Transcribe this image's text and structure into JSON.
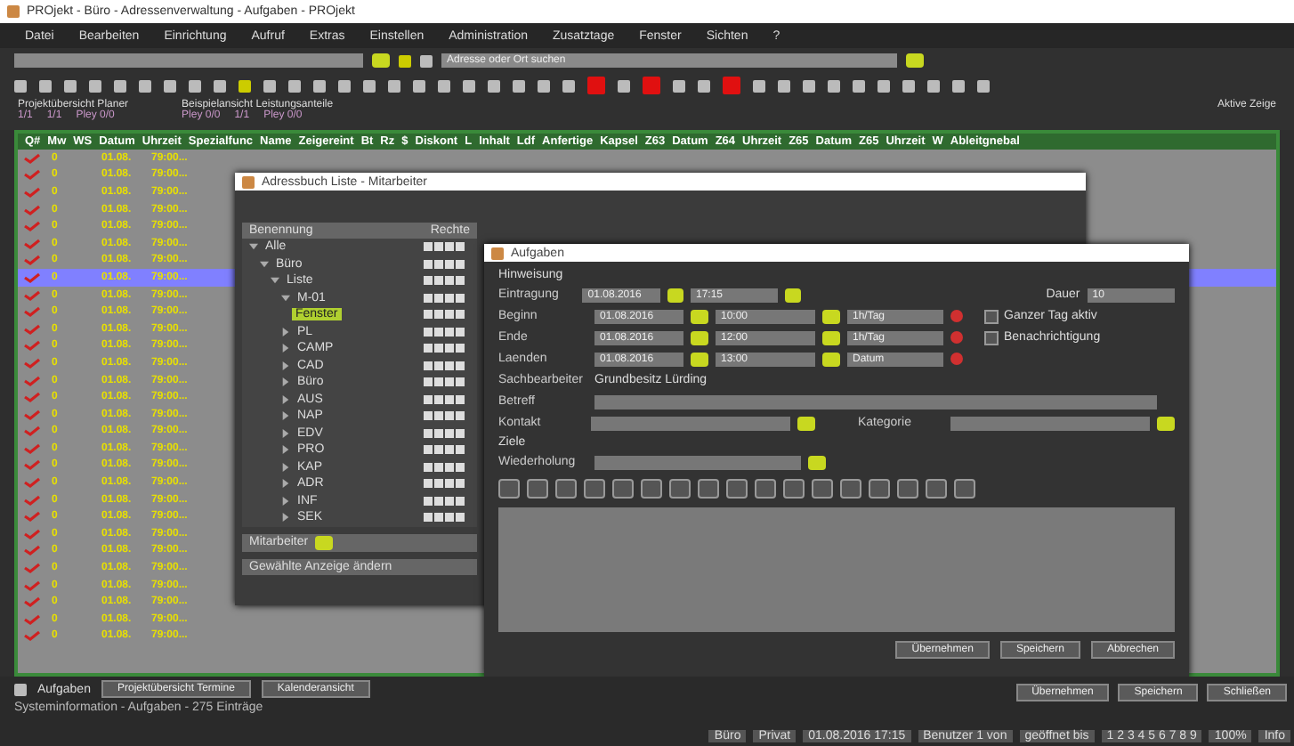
{
  "window": {
    "title": "PROjekt - Büro - Adressenverwaltung - Aufgaben - PROjekt"
  },
  "menu": [
    "Datei",
    "Bearbeiten",
    "Einrichtung",
    "Aufruf",
    "Extras",
    "Einstellen",
    "Administration",
    "Zusatztage",
    "Fenster",
    "Sichten",
    "?"
  ],
  "toolbar": {
    "search_right": "Adresse oder Ort suchen"
  },
  "info": [
    {
      "label": "Projektübersicht Planer",
      "values": [
        "1/1",
        "1/1",
        "Pley 0/0"
      ]
    },
    {
      "label": "Beispielansicht Leistungsanteile",
      "values": [
        "Pley 0/0",
        "1/1",
        "Pley 0/0"
      ]
    }
  ],
  "info_right": "Aktive Zeige",
  "table": {
    "columns": [
      "Q#",
      "Mw",
      "WS",
      "Datum",
      "Uhrzeit",
      "Spezialfunc",
      "Name",
      "Zeigereint",
      "Bt",
      "Rz",
      "$",
      "Diskont",
      "L",
      "Inhalt",
      "Ldf",
      "Anfertige",
      "Kapsel",
      "Z63",
      "Datum",
      "Z64",
      "Uhrzeit",
      "Z65",
      "Datum",
      "Z65",
      "Uhrzeit",
      "W",
      "Ableitgnebal"
    ],
    "rows": [
      {
        "checked": true,
        "selected": false,
        "c1": "0",
        "c2": "01.08.",
        "c3": "79:00..."
      },
      {
        "checked": true,
        "selected": false,
        "c1": "0",
        "c2": "01.08.",
        "c3": "79:00..."
      },
      {
        "checked": true,
        "selected": false,
        "c1": "0",
        "c2": "01.08.",
        "c3": "79:00..."
      },
      {
        "checked": true,
        "selected": false,
        "c1": "0",
        "c2": "01.08.",
        "c3": "79:00..."
      },
      {
        "checked": true,
        "selected": false,
        "c1": "0",
        "c2": "01.08.",
        "c3": "79:00..."
      },
      {
        "checked": true,
        "selected": false,
        "c1": "0",
        "c2": "01.08.",
        "c3": "79:00..."
      },
      {
        "checked": true,
        "selected": false,
        "c1": "0",
        "c2": "01.08.",
        "c3": "79:00..."
      },
      {
        "checked": true,
        "selected": true,
        "c1": "0",
        "c2": "01.08.",
        "c3": "79:00..."
      },
      {
        "checked": true,
        "selected": false,
        "c1": "0",
        "c2": "01.08.",
        "c3": "79:00..."
      },
      {
        "checked": true,
        "selected": false,
        "c1": "0",
        "c2": "01.08.",
        "c3": "79:00..."
      },
      {
        "checked": true,
        "selected": false,
        "c1": "0",
        "c2": "01.08.",
        "c3": "79:00..."
      },
      {
        "checked": true,
        "selected": false,
        "c1": "0",
        "c2": "01.08.",
        "c3": "79:00..."
      },
      {
        "checked": true,
        "selected": false,
        "c1": "0",
        "c2": "01.08.",
        "c3": "79:00..."
      },
      {
        "checked": true,
        "selected": false,
        "c1": "0",
        "c2": "01.08.",
        "c3": "79:00..."
      },
      {
        "checked": true,
        "selected": false,
        "c1": "0",
        "c2": "01.08.",
        "c3": "79:00..."
      },
      {
        "checked": true,
        "selected": false,
        "c1": "0",
        "c2": "01.08.",
        "c3": "79:00..."
      },
      {
        "checked": true,
        "selected": false,
        "c1": "0",
        "c2": "01.08.",
        "c3": "79:00..."
      },
      {
        "checked": true,
        "selected": false,
        "c1": "0",
        "c2": "01.08.",
        "c3": "79:00..."
      },
      {
        "checked": true,
        "selected": false,
        "c1": "0",
        "c2": "01.08.",
        "c3": "79:00..."
      },
      {
        "checked": true,
        "selected": false,
        "c1": "0",
        "c2": "01.08.",
        "c3": "79:00..."
      },
      {
        "checked": true,
        "selected": false,
        "c1": "0",
        "c2": "01.08.",
        "c3": "79:00..."
      },
      {
        "checked": true,
        "selected": false,
        "c1": "0",
        "c2": "01.08.",
        "c3": "79:00..."
      },
      {
        "checked": true,
        "selected": false,
        "c1": "0",
        "c2": "01.08.",
        "c3": "79:00..."
      },
      {
        "checked": true,
        "selected": false,
        "c1": "0",
        "c2": "01.08.",
        "c3": "79:00..."
      },
      {
        "checked": true,
        "selected": false,
        "c1": "0",
        "c2": "01.08.",
        "c3": "79:00..."
      },
      {
        "checked": true,
        "selected": false,
        "c1": "0",
        "c2": "01.08.",
        "c3": "79:00..."
      },
      {
        "checked": true,
        "selected": false,
        "c1": "0",
        "c2": "01.08.",
        "c3": "79:00..."
      },
      {
        "checked": true,
        "selected": false,
        "c1": "0",
        "c2": "01.08.",
        "c3": "79:00..."
      },
      {
        "checked": true,
        "selected": false,
        "c1": "0",
        "c2": "01.08.",
        "c3": "79:00..."
      }
    ]
  },
  "tree_window": {
    "title": "Adressbuch Liste - Mitarbeiter",
    "columns": [
      "Benennung",
      "Rechte"
    ],
    "tree": [
      {
        "label": "Alle",
        "expanded": true,
        "selected": false,
        "children": [
          {
            "label": "Büro",
            "expanded": true,
            "selected": false,
            "children": [
              {
                "label": "Liste",
                "expanded": true,
                "selected": false,
                "children": [
                  {
                    "label": "M-01",
                    "expanded": true,
                    "selected": false,
                    "children": [
                      {
                        "label": "Fenster",
                        "selected": true
                      }
                    ]
                  },
                  {
                    "label": "PL",
                    "expanded": false,
                    "selected": false
                  },
                  {
                    "label": "CAMP",
                    "expanded": false,
                    "selected": false
                  },
                  {
                    "label": "CAD",
                    "expanded": false,
                    "selected": false
                  },
                  {
                    "label": "Büro",
                    "expanded": false,
                    "selected": false
                  },
                  {
                    "label": "AUS",
                    "expanded": false,
                    "selected": false
                  },
                  {
                    "label": "NAP",
                    "expanded": false,
                    "selected": false
                  },
                  {
                    "label": "EDV",
                    "expanded": false,
                    "selected": false
                  },
                  {
                    "label": "PRO",
                    "expanded": false,
                    "selected": false
                  },
                  {
                    "label": "KAP",
                    "expanded": false,
                    "selected": false
                  },
                  {
                    "label": "ADR",
                    "expanded": false,
                    "selected": false
                  },
                  {
                    "label": "INF",
                    "expanded": false,
                    "selected": false
                  },
                  {
                    "label": "SEK",
                    "expanded": false,
                    "selected": false
                  }
                ]
              }
            ]
          }
        ]
      }
    ],
    "filter_label": "Mitarbeiter",
    "footer": "Gewählte Anzeige ändern"
  },
  "dialog": {
    "title": "Aufgaben",
    "section": "Hinweisung",
    "rows": [
      {
        "label": "Eintragung",
        "date": "01.08.2016",
        "time": "17:15"
      },
      {
        "label": "Beginn",
        "date": "01.08.2016",
        "time": "10:00",
        "dur": "1h/Tag"
      },
      {
        "label": "Ende",
        "date": "01.08.2016",
        "time": "12:00",
        "dur": "1h/Tag"
      },
      {
        "label": "Laenden",
        "date": "01.08.2016",
        "time": "13:00",
        "dur": "Datum"
      }
    ],
    "priority_label": "Dauer",
    "priority": "10",
    "options": [
      {
        "label": "Ganzer Tag aktiv",
        "checked": false
      },
      {
        "label": "Benachrichtigung",
        "checked": false
      }
    ],
    "creator_label": "Sachbearbeiter",
    "creator": "Grundbesitz Lürding",
    "subject_label": "Betreff",
    "contact_label": "Kontakt",
    "category_label": "Kategorie",
    "group_label": "Ziele",
    "repeat_label": "Wiederholung",
    "buttons": [
      "Übernehmen",
      "Speichern",
      "Abbrechen"
    ]
  },
  "bottom": {
    "tab": "Aufgaben",
    "buttons": [
      "Projektübersicht Termine",
      "Kalenderansicht"
    ],
    "status": "Systeminformation - Aufgaben - 275 Einträge",
    "right_buttons": [
      "Übernehmen",
      "Speichern",
      "Schließen"
    ]
  },
  "statusbar": {
    "user": "Büro",
    "mode": "Privat",
    "date": "01.08.2016 17:15",
    "info": "Benutzer 1 von",
    "range": "geöffnet bis",
    "pages": "1 2 3 4 5 6 7 8 9",
    "zoom": "100%",
    "last": "Info"
  }
}
